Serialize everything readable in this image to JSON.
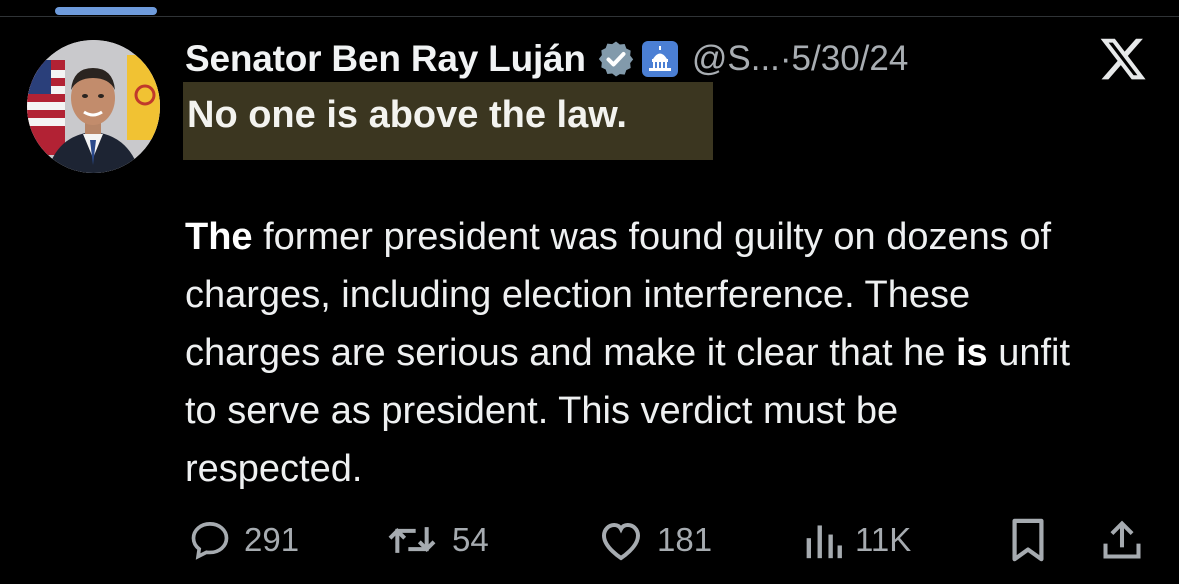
{
  "tweet": {
    "display_name": "Senator Ben Ray Luján",
    "handle": "@S...",
    "separator": " · ",
    "date": "5/30/24",
    "headline": "No one is above the law.",
    "body": {
      "lead_bold": "The",
      "part1": " former president was found guilty on dozens of charges, including election interference. These charges are serious and make it clear that he ",
      "mid_bold": "is",
      "part2": " unfit to serve as president. This verdict must be respected."
    },
    "actions": {
      "replies": "291",
      "reposts": "54",
      "likes": "181",
      "views": "11K"
    }
  },
  "colors": {
    "background": "#000000",
    "text": "#e7e9ea",
    "muted": "#a6abb0",
    "highlight": "#3b3620",
    "verified_badge": "#829aab",
    "capitol_badge": "#4b7fd4"
  },
  "icons": {
    "verified": "verified-badge-icon",
    "capitol": "capitol-building-icon",
    "platform": "x-logo-icon",
    "reply": "reply-icon",
    "repost": "repost-icon",
    "like": "heart-icon",
    "views": "views-chart-icon",
    "bookmark": "bookmark-icon",
    "share": "share-icon"
  }
}
